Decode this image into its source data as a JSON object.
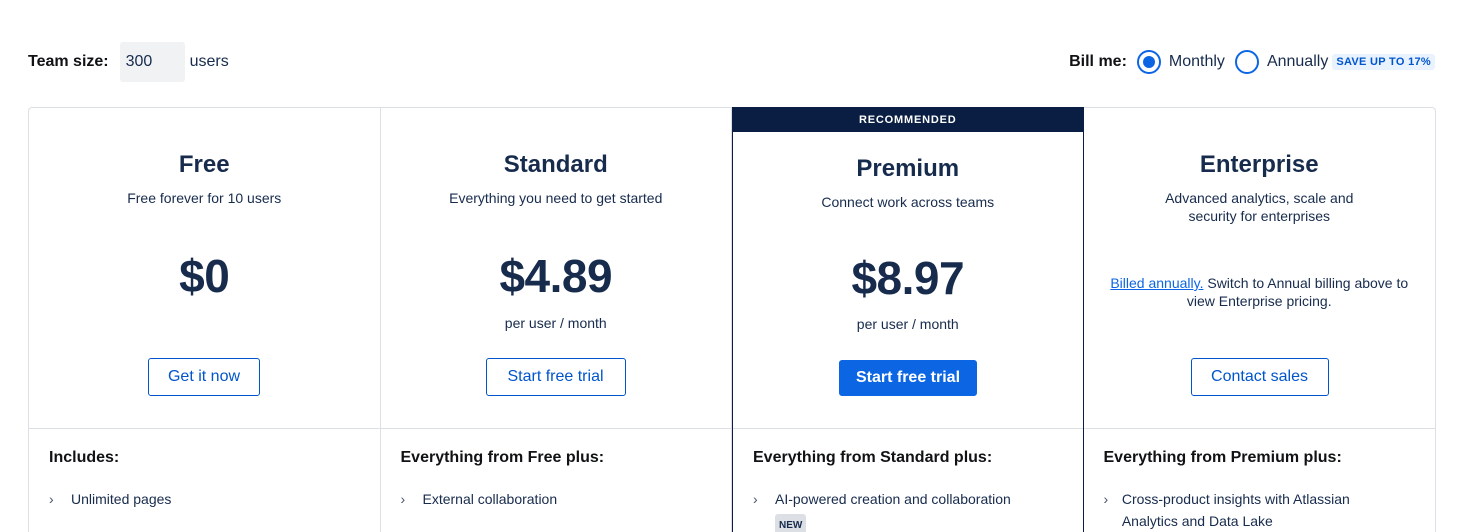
{
  "team_size": {
    "label": "Team size:",
    "value": "300",
    "unit": "users"
  },
  "billing": {
    "label": "Bill me:",
    "options": [
      {
        "label": "Monthly",
        "selected": true
      },
      {
        "label": "Annually",
        "selected": false
      }
    ],
    "save_badge": "SAVE UP TO 17%"
  },
  "plans": [
    {
      "name": "Free",
      "tagline": "Free forever for 10 users",
      "price": "$0",
      "per": "",
      "button": "Get it now",
      "features_title": "Includes:",
      "features": [
        {
          "text": "Unlimited pages"
        }
      ]
    },
    {
      "name": "Standard",
      "tagline": "Everything you need to get started",
      "price": "$4.89",
      "per": "per user / month",
      "button": "Start free trial",
      "features_title": "Everything from Free plus:",
      "features": [
        {
          "text": "External collaboration"
        }
      ]
    },
    {
      "name": "Premium",
      "banner": "RECOMMENDED",
      "tagline": "Connect work across teams",
      "price": "$8.97",
      "per": "per user / month",
      "button": "Start free trial",
      "features_title": "Everything from Standard plus:",
      "features": [
        {
          "text": "AI-powered creation and collaboration",
          "badge": "NEW"
        }
      ]
    },
    {
      "name": "Enterprise",
      "tagline": "Advanced analytics, scale and security for enterprises",
      "note_link": "Billed annually.",
      "note_text": " Switch to Annual billing above to view Enterprise pricing.",
      "button": "Contact sales",
      "features_title": "Everything from Premium plus:",
      "features": [
        {
          "text": "Cross-product insights with Atlassian Analytics and Data Lake"
        }
      ]
    }
  ],
  "colors": {
    "accent": "#0c66e4",
    "dark": "#091e42",
    "text": "#172b4d",
    "border": "#dcdfe4"
  },
  "icons": {
    "feature_bullet": "chevron-right-icon"
  }
}
